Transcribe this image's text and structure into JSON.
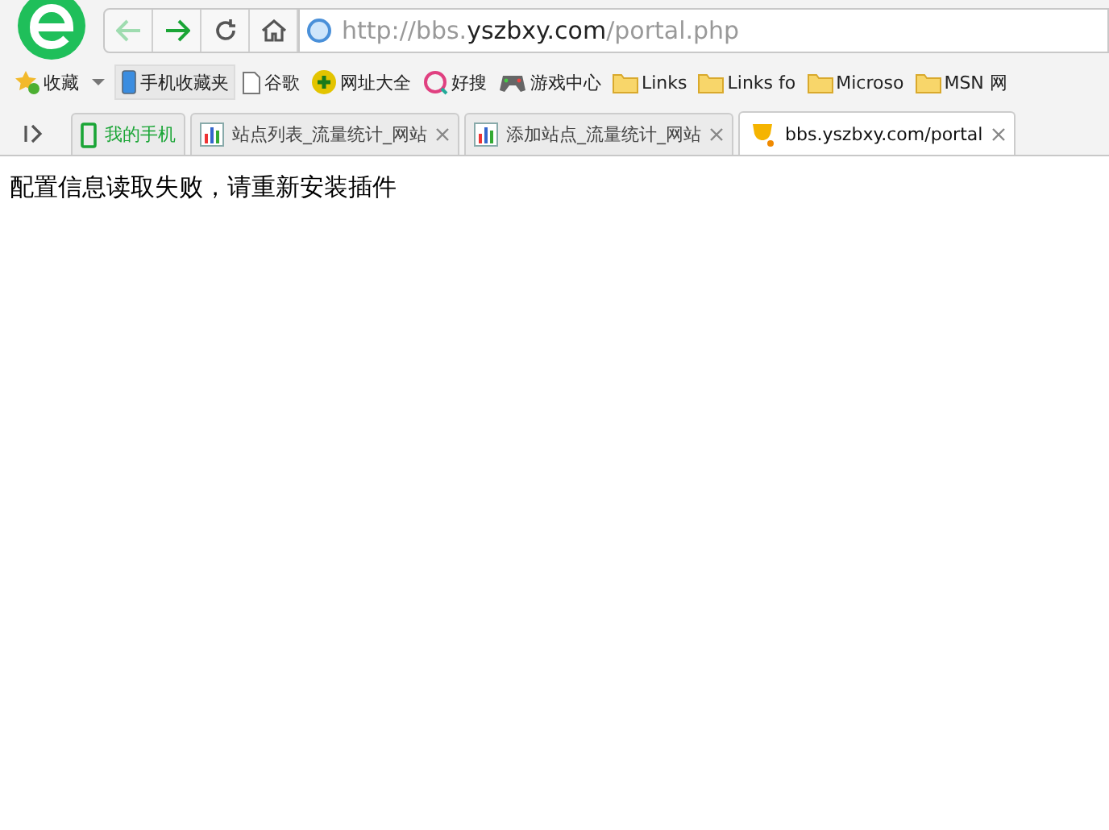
{
  "address_bar": {
    "url_parts": [
      {
        "text": "http://bbs.",
        "kind": "dim"
      },
      {
        "text": "yszbxy.com",
        "kind": "host"
      },
      {
        "text": "/portal.php",
        "kind": "dim"
      }
    ]
  },
  "bookmarks": [
    {
      "label": "收藏",
      "kind": "favorites"
    },
    {
      "label": "手机收藏夹",
      "kind": "phone"
    },
    {
      "label": "谷歌",
      "kind": "page"
    },
    {
      "label": "网址大全",
      "kind": "plus"
    },
    {
      "label": "好搜",
      "kind": "search"
    },
    {
      "label": "游戏中心",
      "kind": "gamepad"
    },
    {
      "label": "Links",
      "kind": "folder"
    },
    {
      "label": "Links fo",
      "kind": "folder"
    },
    {
      "label": "Microso",
      "kind": "folder"
    },
    {
      "label": "MSN 网",
      "kind": "folder"
    }
  ],
  "tabs": [
    {
      "label": "我的手机",
      "kind": "phone",
      "selected": false
    },
    {
      "label": "站点列表_流量统计_网站",
      "kind": "chart",
      "selected": false
    },
    {
      "label": "添加站点_流量统计_网站",
      "kind": "chart",
      "selected": false
    },
    {
      "label": "bbs.yszbxy.com/portal",
      "kind": "trophy",
      "selected": true
    }
  ],
  "page": {
    "message": "配置信息读取失败，请重新安装插件"
  }
}
